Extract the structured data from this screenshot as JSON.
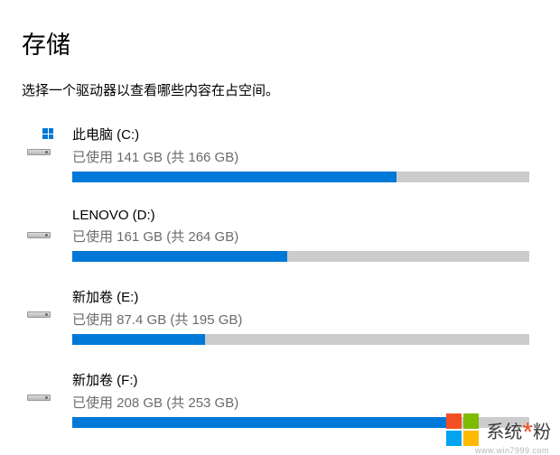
{
  "page": {
    "title": "存储",
    "subtitle": "选择一个驱动器以查看哪些内容在占空间。"
  },
  "drives": [
    {
      "name": "此电脑 (C:)",
      "usage_text": "已使用 141 GB (共 166 GB)",
      "used_gb": 141,
      "total_gb": 166,
      "percent": 71,
      "is_system": true
    },
    {
      "name": "LENOVO (D:)",
      "usage_text": "已使用 161 GB (共 264 GB)",
      "used_gb": 161,
      "total_gb": 264,
      "percent": 47,
      "is_system": false
    },
    {
      "name": "新加卷 (E:)",
      "usage_text": "已使用 87.4 GB (共 195 GB)",
      "used_gb": 87.4,
      "total_gb": 195,
      "percent": 29,
      "is_system": false
    },
    {
      "name": "新加卷 (F:)",
      "usage_text": "已使用 208 GB (共 253 GB)",
      "used_gb": 208,
      "total_gb": 253,
      "percent": 82,
      "is_system": false
    }
  ],
  "watermark": {
    "text_a": "系统",
    "text_b": "粉",
    "url": "www.win7999.com"
  },
  "colors": {
    "progress_fill": "#0078d7",
    "progress_track": "#cccccc"
  }
}
